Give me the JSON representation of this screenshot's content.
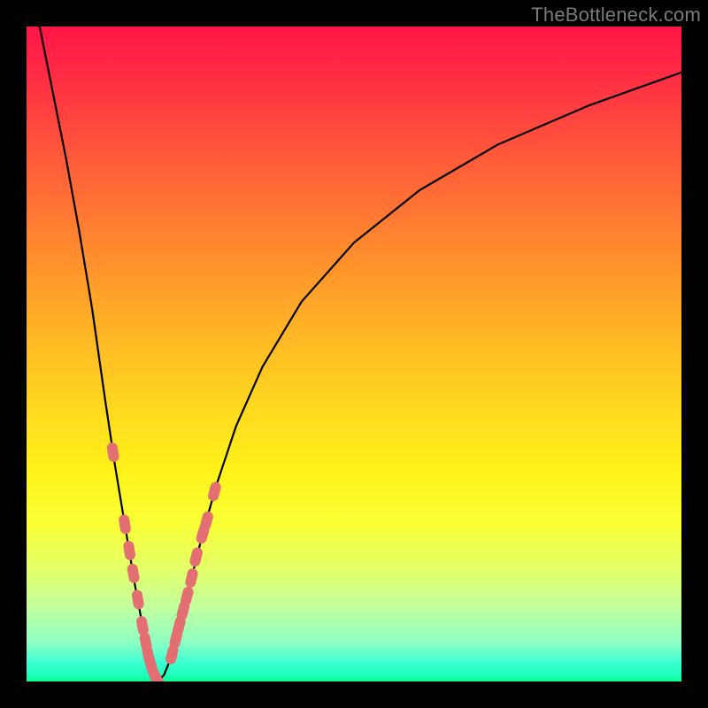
{
  "watermark": "TheBottleneck.com",
  "colors": {
    "frame": "#000000",
    "curve": "#000000",
    "marker": "#e46f73",
    "gradient_stops": [
      "#ff1547",
      "#ff2e44",
      "#ff5a3a",
      "#ff8a2e",
      "#ffb326",
      "#ffd81f",
      "#fff31a",
      "#faff36",
      "#e2ff6a",
      "#c0ffa0",
      "#8effc4",
      "#40ffd0",
      "#1effbc",
      "#0bff90"
    ]
  },
  "chart_data": {
    "type": "line",
    "title": "",
    "xlabel": "",
    "ylabel": "",
    "xlim": [
      0,
      100
    ],
    "ylim": [
      0,
      100
    ],
    "grid": false,
    "legend": false,
    "series": [
      {
        "name": "curve",
        "x": [
          2,
          4,
          6,
          8,
          10,
          12,
          13.5,
          15,
          16.5,
          17.8,
          18.8,
          19.5,
          20,
          21,
          22,
          23,
          24,
          25,
          27,
          29,
          32,
          36,
          42,
          50,
          60,
          72,
          86,
          100
        ],
        "values": [
          100,
          90,
          80,
          69,
          57,
          43,
          33,
          24,
          15,
          8,
          3.5,
          1,
          0,
          1,
          3.5,
          7,
          11,
          15,
          23,
          30,
          39,
          48,
          58,
          67,
          75,
          82,
          88,
          93
        ]
      },
      {
        "name": "left_markers",
        "type": "scatter",
        "x": [
          13.2,
          15.0,
          15.7,
          16.3,
          17.0,
          17.7,
          18.2,
          18.6,
          19.0,
          19.4,
          19.8
        ],
        "values": [
          35.0,
          24.0,
          20.0,
          16.5,
          12.5,
          8.5,
          6.0,
          4.0,
          2.5,
          1.3,
          0.5
        ]
      },
      {
        "name": "right_markers",
        "type": "scatter",
        "x": [
          22.2,
          22.8,
          23.3,
          23.9,
          24.5,
          25.2,
          25.9,
          26.9,
          27.5,
          28.7
        ],
        "values": [
          4.1,
          6.5,
          8.5,
          10.8,
          13.0,
          15.8,
          19.0,
          22.5,
          24.5,
          29.0
        ]
      }
    ]
  }
}
